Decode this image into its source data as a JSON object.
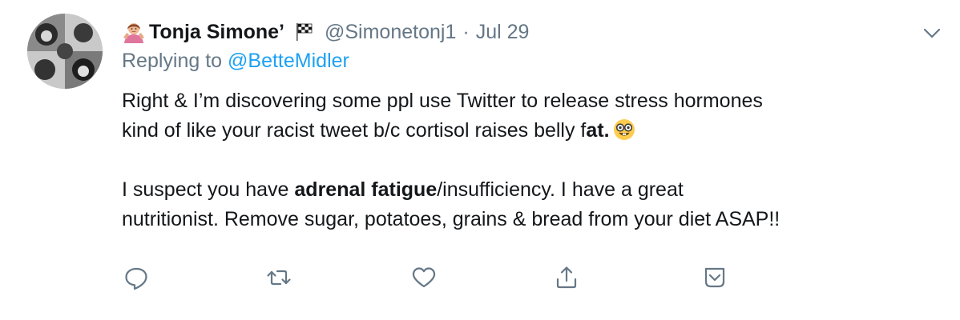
{
  "author": {
    "name": "Tonja Simone’",
    "handle": "@Simonetonj1",
    "separator": "·",
    "date": "Jul 29",
    "avatar_icon": "profile-photo",
    "name_emoji_icon": "person-shrugging-emoji",
    "flag_icon": "chequered-flag-emoji"
  },
  "reply": {
    "prefix": "Replying to ",
    "mention": "@BetteMidler"
  },
  "body": {
    "line1": "Right & I’m discovering some ppl use Twitter to release stress hormones",
    "line2_text": "kind of like your racist tweet b/c cortisol raises belly f",
    "line2_bold": "at.",
    "line2_emoji_icon": "nerd-face-emoji",
    "p2_line1_start": "I suspect you have ",
    "p2_line1_bold": "adrenal fatigue",
    "p2_line1_end": "/insufficiency. I have a great",
    "p2_line2": "nutritionist. Remove sugar, potatoes, grains & bread from your diet ASAP!!"
  },
  "actions": [
    "reply-icon",
    "retweet-icon",
    "like-icon",
    "share-icon",
    "save-icon"
  ],
  "colors": {
    "text": "#14171a",
    "secondary": "#657786",
    "link": "#1da1f2"
  }
}
